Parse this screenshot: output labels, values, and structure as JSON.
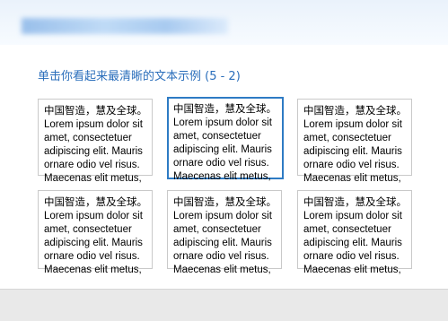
{
  "dialog": {
    "heading": "单击你看起来最清晰的文本示例 (5 - 2)"
  },
  "samples": [
    {
      "text": "中国智造，慧及全球。\nLorem ipsum dolor sit\namet, consectetuer\nadipiscing elit. Mauris\nornare odio vel risus.\nMaecenas elit metus,",
      "selected": false
    },
    {
      "text": "中国智造，慧及全球。\nLorem ipsum dolor sit\namet, consectetuer\nadipiscing elit. Mauris\nornare odio vel risus.\nMaecenas elit metus,",
      "selected": true
    },
    {
      "text": "中国智造，慧及全球。\nLorem ipsum dolor sit\namet, consectetuer\nadipiscing elit. Mauris\nornare odio vel risus.\nMaecenas elit metus,",
      "selected": false
    },
    {
      "text": "中国智造，慧及全球。\nLorem ipsum dolor sit\namet, consectetuer\nadipiscing elit. Mauris\nornare odio vel risus.\nMaecenas elit metus,",
      "selected": false
    },
    {
      "text": "中国智造，慧及全球。\nLorem ipsum dolor sit\namet, consectetuer\nadipiscing elit. Mauris\nornare odio vel risus.\nMaecenas elit metus,",
      "selected": false
    },
    {
      "text": "中国智造，慧及全球。\nLorem ipsum dolor sit\namet, consectetuer\nadipiscing elit. Mauris\nornare odio vel risus.\nMaecenas elit metus,",
      "selected": false
    }
  ],
  "colors": {
    "accent": "#2a6ebb",
    "selected_border": "#2e7bc4"
  }
}
